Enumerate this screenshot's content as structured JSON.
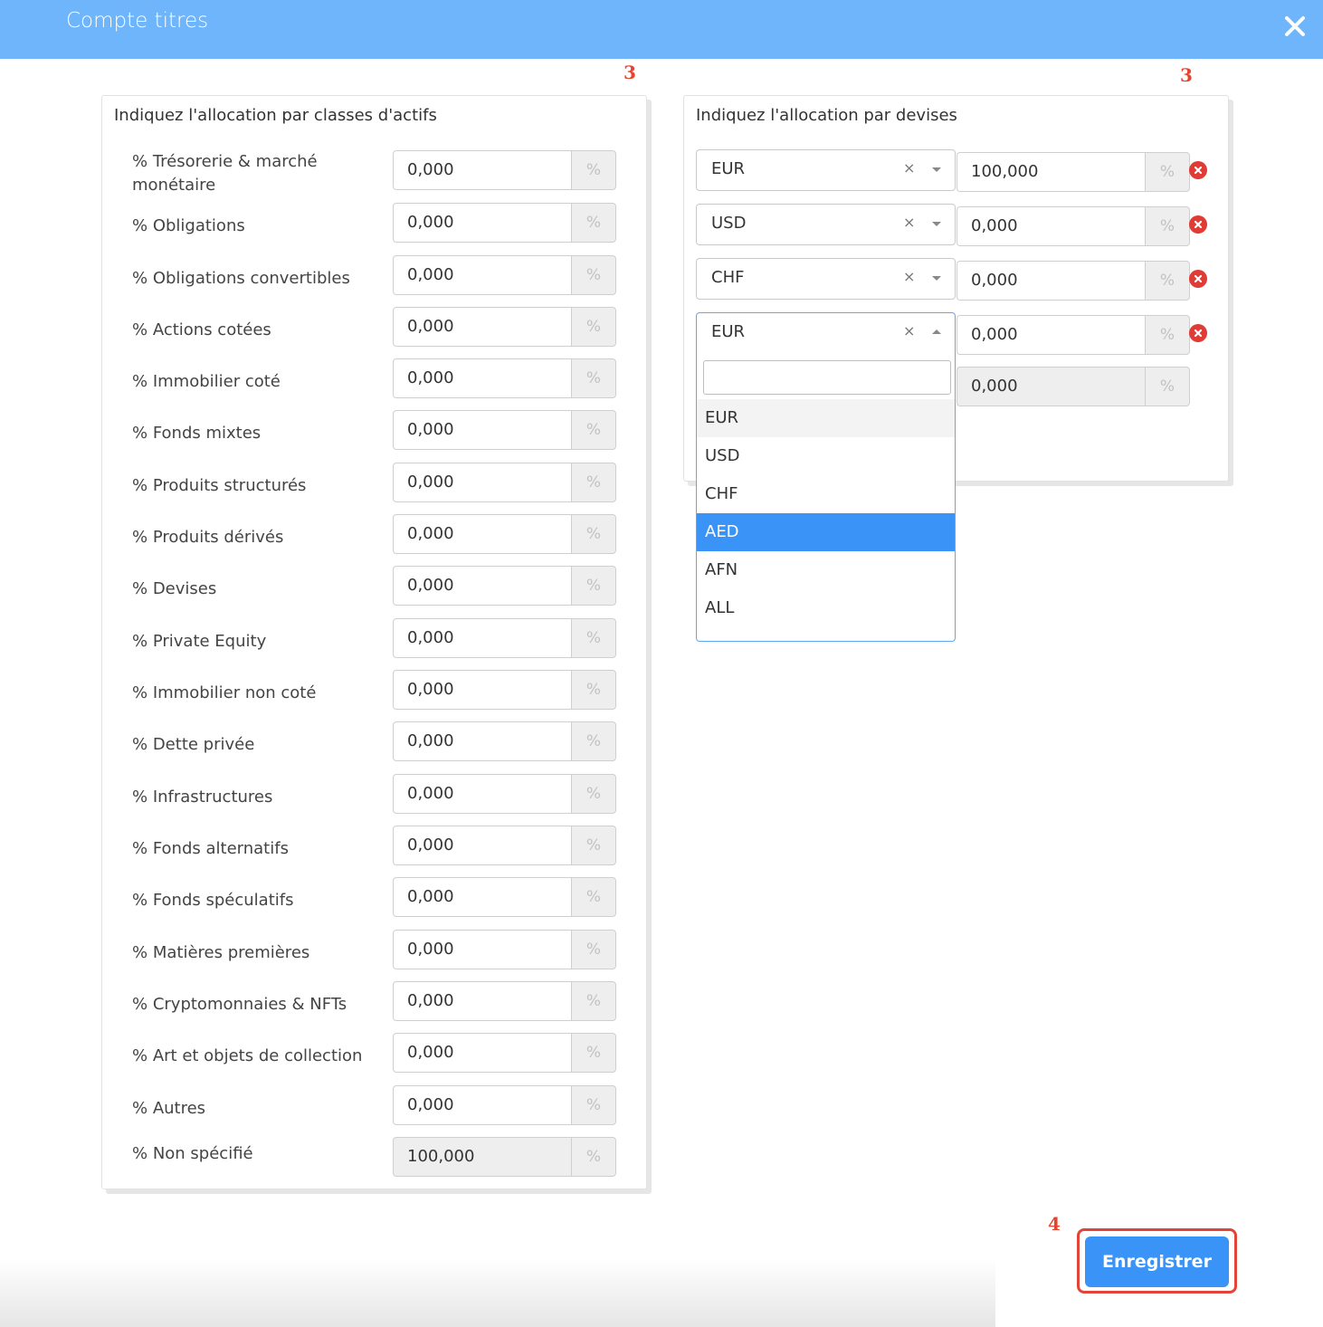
{
  "header": {
    "title": "Compte titres",
    "close_icon": "close-icon"
  },
  "annotations": {
    "left_step": "3",
    "right_step": "3",
    "save_step": "4",
    "color": "#e8432e"
  },
  "asset_panel": {
    "title": "Indiquez l'allocation par classes d'actifs",
    "unit": "%",
    "rows": [
      {
        "label": "% Trésorerie & marché monétaire",
        "value": "0,000"
      },
      {
        "label": "% Obligations",
        "value": "0,000"
      },
      {
        "label": "% Obligations convertibles",
        "value": "0,000"
      },
      {
        "label": "% Actions cotées",
        "value": "0,000"
      },
      {
        "label": "% Immobilier coté",
        "value": "0,000"
      },
      {
        "label": "% Fonds mixtes",
        "value": "0,000"
      },
      {
        "label": "% Produits structurés",
        "value": "0,000"
      },
      {
        "label": "% Produits dérivés",
        "value": "0,000"
      },
      {
        "label": "% Devises",
        "value": "0,000"
      },
      {
        "label": "% Private Equity",
        "value": "0,000"
      },
      {
        "label": "% Immobilier non coté",
        "value": "0,000"
      },
      {
        "label": "% Dette privée",
        "value": "0,000"
      },
      {
        "label": "% Infrastructures",
        "value": "0,000"
      },
      {
        "label": "% Fonds alternatifs",
        "value": "0,000"
      },
      {
        "label": "% Fonds spéculatifs",
        "value": "0,000"
      },
      {
        "label": "% Matières premières",
        "value": "0,000"
      },
      {
        "label": "% Cryptomonnaies & NFTs",
        "value": "0,000"
      },
      {
        "label": "% Art et objets de collection",
        "value": "0,000"
      },
      {
        "label": "% Autres",
        "value": "0,000"
      }
    ],
    "unspecified": {
      "label": "% Non spécifié",
      "value": "100,000"
    }
  },
  "currency_panel": {
    "title": "Indiquez l'allocation par devises",
    "unit": "%",
    "clear_symbol": "×",
    "rows": [
      {
        "currency": "EUR",
        "value": "100,000"
      },
      {
        "currency": "USD",
        "value": "0,000"
      },
      {
        "currency": "CHF",
        "value": "0,000"
      },
      {
        "currency": "EUR",
        "value": "0,000"
      }
    ],
    "remaining": {
      "value": "0,000"
    },
    "dropdown": {
      "search_value": "",
      "options": [
        "EUR",
        "USD",
        "CHF",
        "AED",
        "AFN",
        "ALL"
      ],
      "selected_option": "EUR",
      "hovered_option": "AED",
      "highlight_color": "#3a93f6"
    }
  },
  "footer": {
    "save_label": "Enregistrer",
    "accent": "#3a93f6",
    "outline_color": "#e0453a"
  }
}
